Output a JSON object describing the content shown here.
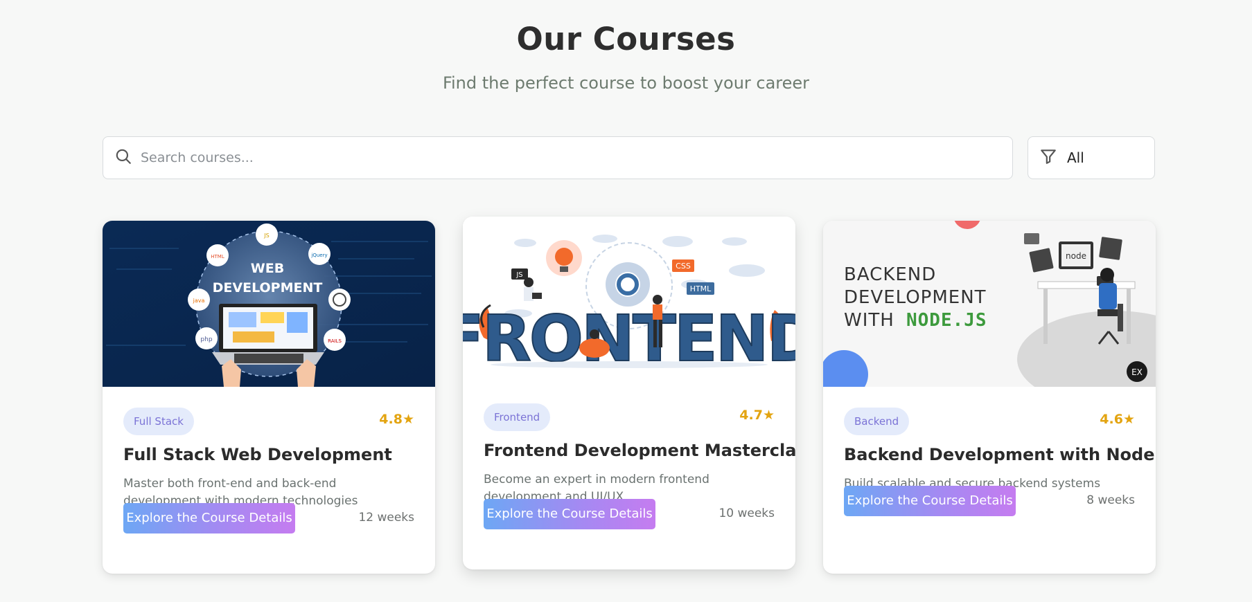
{
  "header": {
    "title": "Our Courses",
    "subtitle": "Find the perfect course to boost your career"
  },
  "search": {
    "placeholder": "Search courses...",
    "value": "",
    "icon": "search-icon"
  },
  "filter": {
    "icon": "filter-icon",
    "selected": "All"
  },
  "colors": {
    "badge_bg": "#e4ebfb",
    "badge_text": "#7b73d6",
    "rating": "#e3a411",
    "button_gradient_start": "#6da7f4",
    "button_gradient_end": "#c57cf0"
  },
  "courses": [
    {
      "category": "Full Stack",
      "rating": "4.8★",
      "title": "Full Stack Web Development",
      "description": "Master both front-end and back-end development with modern technologies",
      "button_label": "Explore the Course Details",
      "duration": "12 weeks",
      "image": {
        "heading_line1": "WEB",
        "heading_line2": "DEVELOPMENT",
        "badges": [
          "HTML",
          "JS",
          "jQuery",
          "java",
          "php",
          "RAILS"
        ]
      }
    },
    {
      "category": "Frontend",
      "rating": "4.7★",
      "title": "Frontend Development Masterclass",
      "description": "Become an expert in modern frontend development and UI/UX",
      "button_label": "Explore the Course Details",
      "duration": "10 weeks",
      "image": {
        "word": "FRONTEND",
        "tags": [
          "JS",
          "CSS",
          "HTML"
        ]
      }
    },
    {
      "category": "Backend",
      "rating": "4.6★",
      "title": "Backend Development with Node.js",
      "description": "Build scalable and secure backend systems",
      "button_label": "Explore the Course Details",
      "duration": "8 weeks",
      "image": {
        "line1": "BACKEND",
        "line2": "DEVELOPMENT",
        "line3_prefix": "WITH",
        "line3_highlight": "NODE.JS",
        "screen_text": "node",
        "logo": "EX"
      }
    }
  ]
}
